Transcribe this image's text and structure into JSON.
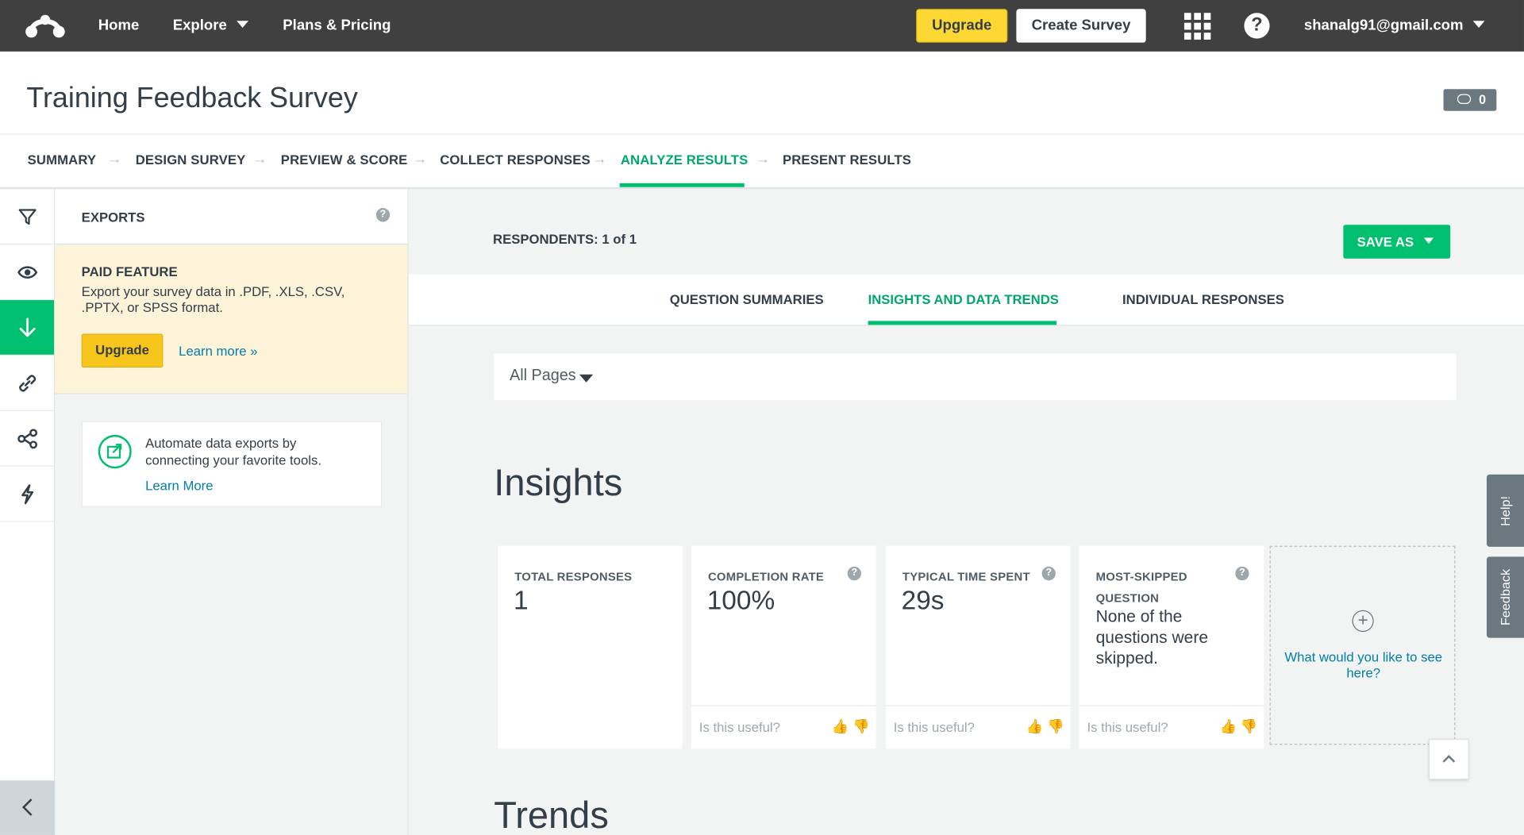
{
  "topnav": {
    "home": "Home",
    "explore": "Explore",
    "plans": "Plans & Pricing",
    "upgrade": "Upgrade",
    "create_survey": "Create Survey",
    "help": "?",
    "account": "shanalg91@gmail.com"
  },
  "survey": {
    "title": "Training Feedback Survey",
    "comment_count": "0"
  },
  "steps": [
    {
      "label": "SUMMARY"
    },
    {
      "label": "DESIGN SURVEY"
    },
    {
      "label": "PREVIEW & SCORE"
    },
    {
      "label": "COLLECT RESPONSES"
    },
    {
      "label": "ANALYZE RESULTS",
      "active": true
    },
    {
      "label": "PRESENT RESULTS"
    }
  ],
  "step_arrow": "→",
  "panel": {
    "title": "EXPORTS",
    "help": "?",
    "paid_title": "PAID FEATURE",
    "paid_desc": "Export your survey data in .PDF, .XLS, .CSV, .PPTX, or SPSS format.",
    "upgrade": "Upgrade",
    "learn_more": "Learn more »",
    "automate_text": "Automate data exports by connecting your favorite tools.",
    "automate_link": "Learn More"
  },
  "main": {
    "respondents": "RESPONDENTS: 1 of 1",
    "save_as": "SAVE AS",
    "tabs": [
      {
        "label": "QUESTION SUMMARIES"
      },
      {
        "label": "INSIGHTS AND DATA TRENDS",
        "active": true
      },
      {
        "label": "INDIVIDUAL RESPONSES"
      }
    ],
    "page_filter": "All Pages",
    "insights_heading": "Insights",
    "trends_heading": "Trends",
    "cards": [
      {
        "label": "TOTAL RESPONSES",
        "value": "1"
      },
      {
        "label": "COMPLETION RATE",
        "value": "100%",
        "useful": "Is this useful?"
      },
      {
        "label": "TYPICAL TIME SPENT",
        "value": "29s",
        "useful": "Is this useful?"
      },
      {
        "label": "MOST-SKIPPED QUESTION",
        "value": "None of the questions were skipped.",
        "useful": "Is this useful?"
      }
    ],
    "add_card": "What would you like to see here?",
    "help_q": "?"
  },
  "side_tabs": {
    "help": "Help!",
    "feedback": "Feedback"
  },
  "colors": {
    "accent_green": "#00bf6f",
    "topnav_bg": "#404040",
    "upgrade_yellow": "#fdd835",
    "link_blue": "#007faa"
  }
}
